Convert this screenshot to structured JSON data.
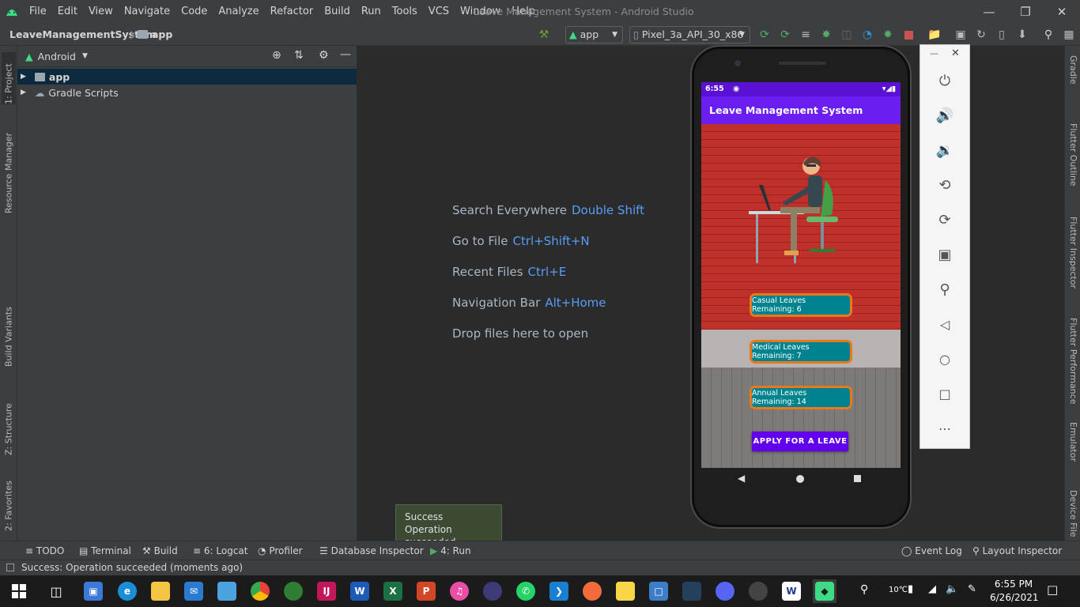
{
  "window": {
    "title": "Leave Management System - Android Studio",
    "menu": [
      "File",
      "Edit",
      "View",
      "Navigate",
      "Code",
      "Analyze",
      "Refactor",
      "Build",
      "Run",
      "Tools",
      "VCS",
      "Window",
      "Help"
    ]
  },
  "navbar": {
    "project": "LeaveManagementSystem",
    "module": "app",
    "run_config": "app",
    "device": "Pixel_3a_API_30_x86"
  },
  "left_strip": {
    "project_tab": "1: Project",
    "resource_manager": "Resource Manager",
    "build_variants": "Build Variants",
    "structure": "Z: Structure",
    "favorites": "2: Favorites"
  },
  "project_panel": {
    "view": "Android",
    "tree": [
      "app",
      "Gradle Scripts"
    ]
  },
  "editor_hints": [
    {
      "label": "Search Everywhere",
      "key": "Double Shift"
    },
    {
      "label": "Go to File",
      "key": "Ctrl+Shift+N"
    },
    {
      "label": "Recent Files",
      "key": "Ctrl+E"
    },
    {
      "label": "Navigation Bar",
      "key": "Alt+Home"
    },
    {
      "label": "Drop files here to open",
      "key": ""
    }
  ],
  "right_strip": [
    "Gradle",
    "Flutter Outline",
    "Flutter Inspector",
    "Flutter Performance",
    "Emulator",
    "Device File"
  ],
  "bottom_tabs": {
    "todo": "TODO",
    "terminal": "Terminal",
    "build": "Build",
    "logcat": "6: Logcat",
    "profiler": "Profiler",
    "db_inspector": "Database Inspector",
    "run": "4: Run",
    "event_log": "Event Log",
    "layout_inspector": "Layout Inspector"
  },
  "balloon": {
    "title": "Success",
    "message": "Operation succeeded"
  },
  "status_message": "Success: Operation succeeded (moments ago)",
  "phone": {
    "time": "6:55",
    "app_title": "Leave Management System",
    "casual": "Casual Leaves Remaining: 6",
    "medical": "Medical Leaves Remaining: 7",
    "annual": "Annual Leaves Remaining: 14",
    "apply_button": "APPLY FOR A LEAVE"
  },
  "taskbar": {
    "time": "6:55 PM",
    "date": "6/26/2021"
  },
  "colors": {
    "ide_bg": "#2b2b2b",
    "panel_bg": "#3c3f41",
    "link_key": "#589df6",
    "app_bar": "#6a1ff0",
    "chip": "#00838f",
    "chip_border": "#e8791a",
    "button": "#6200ee"
  }
}
